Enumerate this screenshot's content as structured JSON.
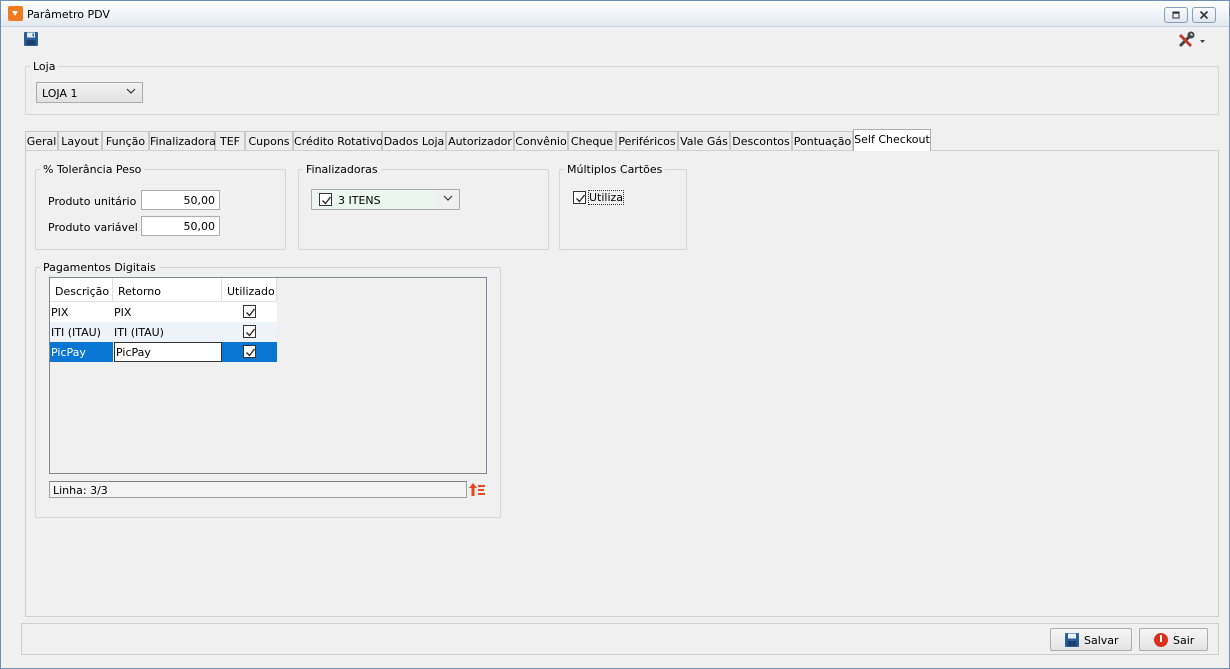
{
  "window": {
    "title": "Parâmetro PDV"
  },
  "loja": {
    "legend": "Loja",
    "selected": "LOJA 1"
  },
  "tabs": [
    {
      "label": "Geral"
    },
    {
      "label": "Layout"
    },
    {
      "label": "Função"
    },
    {
      "label": "Finalizadora"
    },
    {
      "label": "TEF"
    },
    {
      "label": "Cupons"
    },
    {
      "label": "Crédito Rotativo"
    },
    {
      "label": "Dados Loja"
    },
    {
      "label": "Autorizador"
    },
    {
      "label": "Convênio"
    },
    {
      "label": "Cheque"
    },
    {
      "label": "Periféricos"
    },
    {
      "label": "Vale Gás"
    },
    {
      "label": "Descontos"
    },
    {
      "label": "Pontuação"
    },
    {
      "label": "Self Checkout"
    }
  ],
  "active_tab": "Self Checkout",
  "tolerancia": {
    "legend": "% Tolerância Peso",
    "unit_label": "Produto unitário",
    "unit_value": "50,00",
    "var_label": "Produto variável",
    "var_value": "50,00"
  },
  "finalizadoras": {
    "legend": "Finalizadoras",
    "selected": "3 ITENS",
    "checked": true
  },
  "multiplos": {
    "legend": "Múltiplos Cartões",
    "utiliza_label": "Utiliza",
    "checked": true
  },
  "pagamentos": {
    "legend": "Pagamentos Digitais",
    "columns": {
      "descricao": "Descrição",
      "retorno": "Retorno",
      "utilizado": "Utilizado"
    },
    "rows": [
      {
        "descricao": "PIX",
        "retorno": "PIX",
        "utilizado": true
      },
      {
        "descricao": "ITI (ITAU)",
        "retorno": "ITI (ITAU)",
        "utilizado": true
      },
      {
        "descricao": "PicPay",
        "retorno": "PicPay",
        "utilizado": true
      }
    ],
    "status": "Linha: 3/3"
  },
  "buttons": {
    "salvar": "Salvar",
    "sair": "Sair"
  },
  "colors": {
    "accent": "#0a76d3",
    "app_icon": "#f07a1e",
    "sair_icon": "#d9321c"
  }
}
